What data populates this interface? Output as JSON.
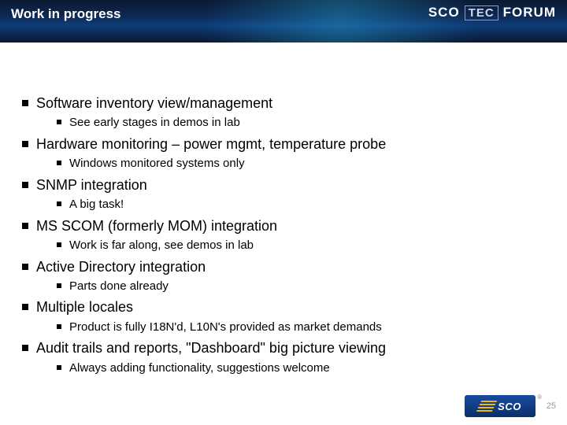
{
  "header": {
    "title": "Work in progress",
    "brand_sco": "SCO",
    "brand_tec": "TEC",
    "brand_forum": "FORUM"
  },
  "bullets": [
    {
      "text": "Software inventory view/management",
      "sub": [
        "See early stages in demos in lab"
      ]
    },
    {
      "text": "Hardware monitoring – power mgmt, temperature probe",
      "sub": [
        "Windows monitored systems only"
      ]
    },
    {
      "text": "SNMP integration",
      "sub": [
        "A big task!"
      ]
    },
    {
      "text": "MS SCOM (formerly MOM) integration",
      "sub": [
        "Work is far along, see demos in lab"
      ]
    },
    {
      "text": "Active Directory integration",
      "sub": [
        "Parts done already"
      ]
    },
    {
      "text": "Multiple locales",
      "sub": [
        "Product is fully I18N'd, L10N's provided as market demands"
      ]
    },
    {
      "text": "Audit trails and reports, \"Dashboard\" big picture viewing",
      "sub": [
        "Always adding functionality, suggestions welcome"
      ]
    }
  ],
  "footer": {
    "logo_text": "SCO",
    "page_number": "25"
  }
}
